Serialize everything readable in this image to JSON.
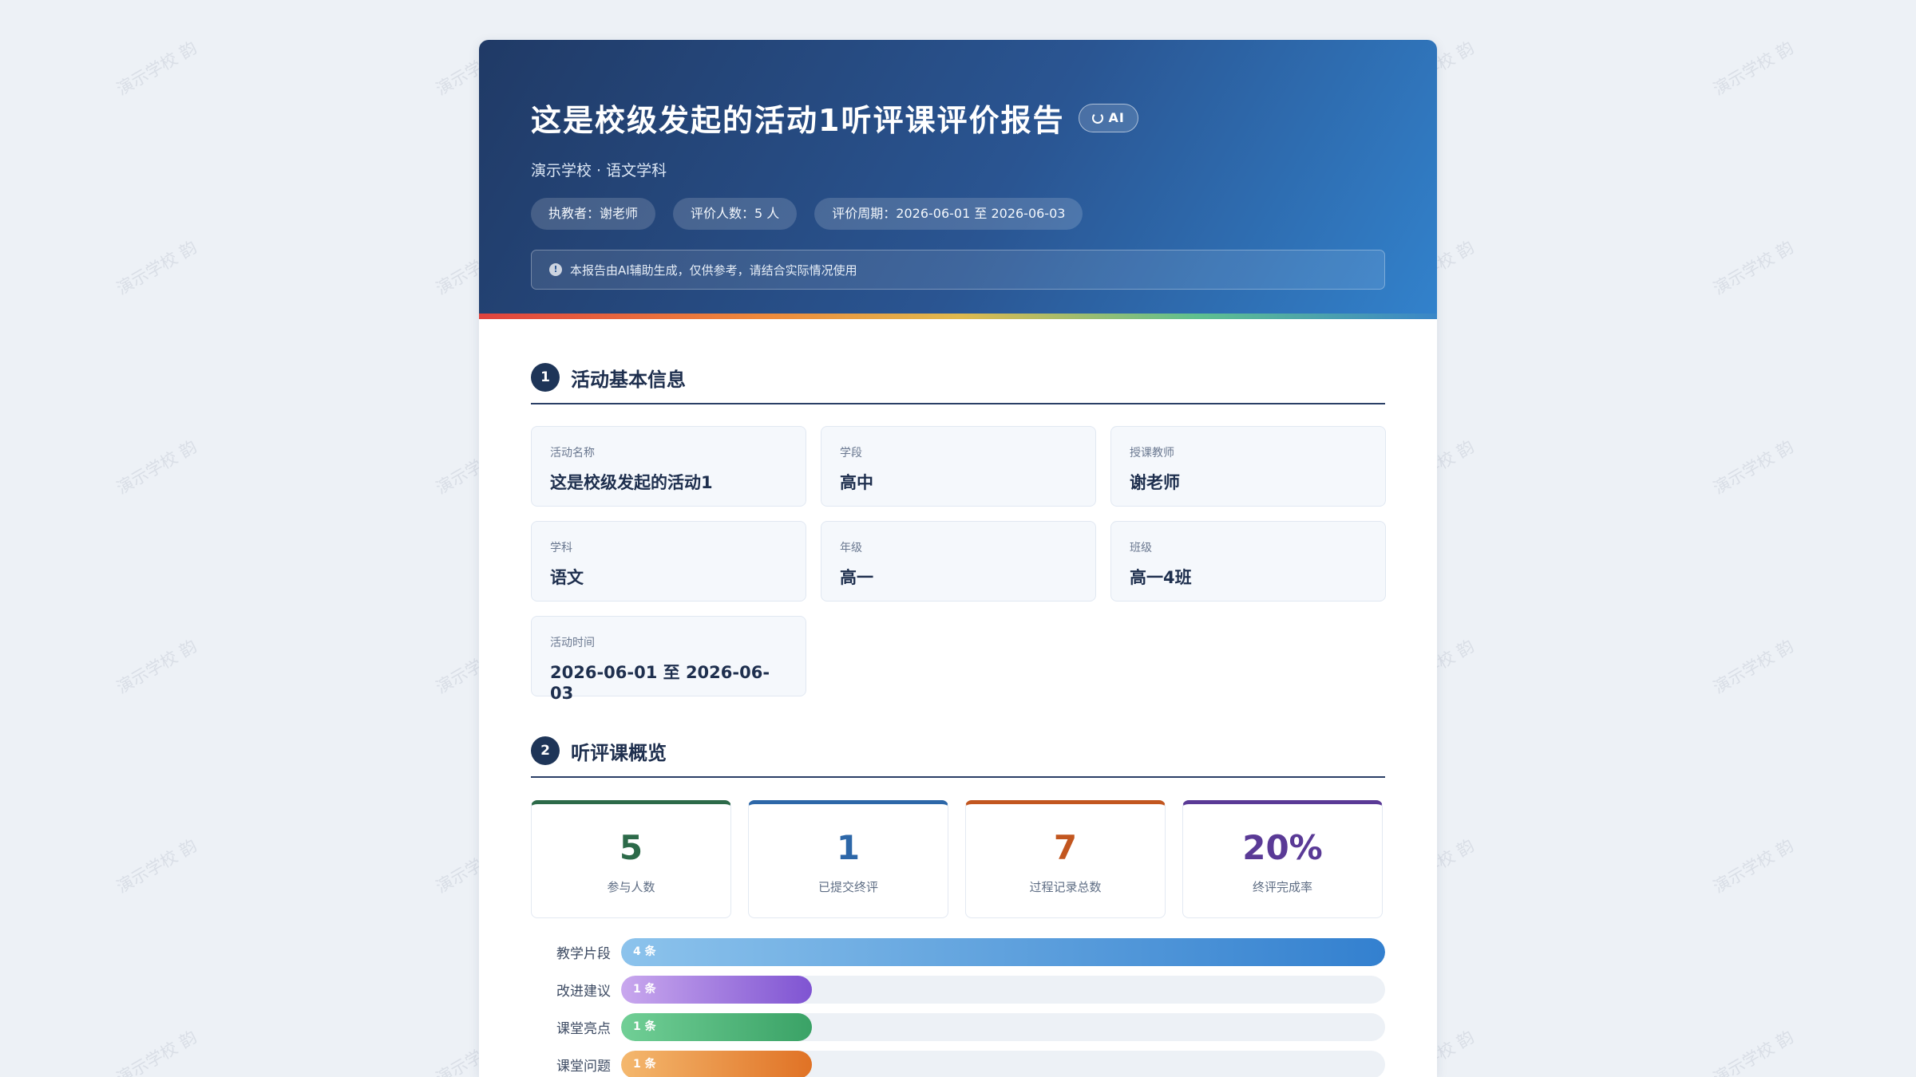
{
  "watermark_text": "演示学校 韵",
  "header": {
    "title": "这是校级发起的活动1听评课评价报告",
    "ai_badge": "AI",
    "subtitle": "演示学校 · 语文学科",
    "chips": [
      "执教者：谢老师",
      "评价人数：5 人",
      "评价周期：2026-06-01 至 2026-06-03"
    ],
    "notice": "本报告由AI辅助生成，仅供参考，请结合实际情况使用"
  },
  "section1": {
    "number": "1",
    "title": "活动基本信息",
    "cards": [
      {
        "label": "活动名称",
        "value": "这是校级发起的活动1"
      },
      {
        "label": "学段",
        "value": "高中"
      },
      {
        "label": "授课教师",
        "value": "谢老师"
      },
      {
        "label": "学科",
        "value": "语文"
      },
      {
        "label": "年级",
        "value": "高一"
      },
      {
        "label": "班级",
        "value": "高一4班"
      },
      {
        "label": "活动时间",
        "value": "2026-06-01 至 2026-06-03"
      }
    ]
  },
  "section2": {
    "number": "2",
    "title": "听评课概览",
    "stats": [
      {
        "value": "5",
        "label": "参与人数",
        "color": "#2c6a49"
      },
      {
        "value": "1",
        "label": "已提交终评",
        "color": "#2d67a8"
      },
      {
        "value": "7",
        "label": "过程记录总数",
        "color": "#c2561f"
      },
      {
        "value": "20%",
        "label": "终评完成率",
        "color": "#5a3a96"
      }
    ]
  },
  "chart_data": {
    "type": "bar",
    "categories": [
      "教学片段",
      "改进建议",
      "课堂亮点",
      "课堂问题"
    ],
    "values": [
      4,
      1,
      1,
      1
    ],
    "value_labels": [
      "4 条",
      "1 条",
      "1 条",
      "1 条"
    ],
    "xlim": [
      0,
      4
    ],
    "colors": [
      [
        "#8cc3ec",
        "#3380cf"
      ],
      [
        "#c9a8ee",
        "#7f54d2"
      ],
      [
        "#71cf96",
        "#3aa266"
      ],
      [
        "#f4b86e",
        "#e07225"
      ]
    ]
  }
}
